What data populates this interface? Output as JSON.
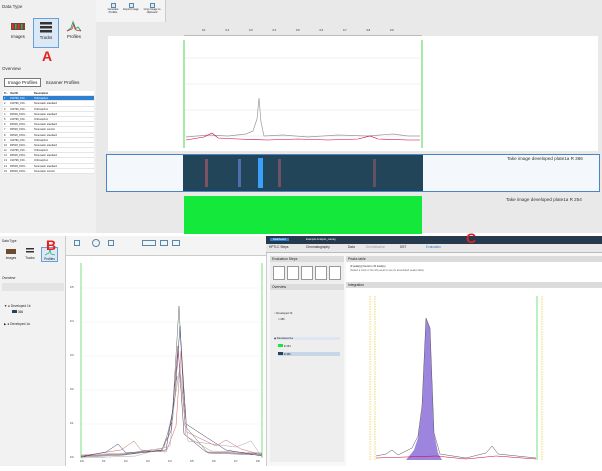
{
  "top_left": {
    "data_type_header": "Data Type",
    "type_buttons": [
      {
        "label": "Images",
        "icon": "images-icon"
      },
      {
        "label": "Tracks",
        "icon": "tracks-icon"
      },
      {
        "label": "Profiles",
        "icon": "profiles-icon"
      }
    ],
    "marker": "A",
    "overview_header": "Overview",
    "tabs": [
      "Image Profiles",
      "Scanner Profiles"
    ],
    "table": {
      "columns": [
        "Tr..",
        "Vial ID",
        "Description"
      ],
      "rows": [
        [
          "1",
          "310796_150...",
          "Orthosiphon"
        ],
        [
          "2",
          "310796_150...",
          "Sinensetin standard"
        ],
        [
          "3",
          "310796_150...",
          "Orthosiphon"
        ],
        [
          "4",
          "R3518_1501...",
          "Sinensetin standard"
        ],
        [
          "5",
          "310796_150...",
          "Orthosiphon"
        ],
        [
          "6",
          "R3518_1501...",
          "Sinensetin standard"
        ],
        [
          "7",
          "R3518_1501...",
          "Sinensetin control"
        ],
        [
          "8",
          "R3518_1501...",
          "Sinensetin standard"
        ],
        [
          "9",
          "310796_150...",
          "Orthosiphon"
        ],
        [
          "10",
          "R3518_1501...",
          "Sinensetin standard"
        ],
        [
          "11",
          "310796_150...",
          "Orthosiphon"
        ],
        [
          "12",
          "R3518_1501...",
          "Sinensetin standard"
        ],
        [
          "13",
          "310796_150...",
          "Orthosiphon"
        ],
        [
          "14",
          "R3518_1501...",
          "Sinensetin standard"
        ],
        [
          "15",
          "R3518_1501...",
          "Sinensetin control"
        ]
      ]
    }
  },
  "top_right": {
    "toolbar": [
      "Generate Profiles",
      "Export Image",
      "Copy Image to clipboard"
    ],
    "rf_ticks": [
      "0.1",
      "0.2",
      "0.3",
      "0.4",
      "0.5",
      "0.6",
      "0.7",
      "0.8",
      "0.9"
    ],
    "caption_366": "Take image developed plate1a R 366",
    "caption_254": "Take image developed plate1a R 254"
  },
  "bottom_left": {
    "data_type_header": "Data Type",
    "type_buttons": [
      {
        "label": "Images",
        "icon": "images-icon"
      },
      {
        "label": "Tracks",
        "icon": "tracks-icon"
      },
      {
        "label": "Profiles",
        "icon": "profiles-icon"
      }
    ],
    "marker": "B",
    "overview_header": "Overview",
    "tree": [
      "Developed 1b",
      "366",
      "Developed 1a"
    ],
    "y_ticks": [
      "0.5",
      "0.4",
      "0.3",
      "0.2",
      "0.1",
      "0.0"
    ],
    "x_ticks": [
      "0.0",
      "0.1",
      "0.2",
      "0.3",
      "0.4",
      "0.5",
      "0.6",
      "0.7",
      "0.8"
    ]
  },
  "bottom_right": {
    "title_tabs": [
      "Dashboard",
      "Example Analysis_camag"
    ],
    "marker": "C",
    "workflow_tabs": [
      "HPTLC Steps",
      "Chromatography",
      "Data",
      "Derivatization",
      "DST",
      "Evaluation"
    ],
    "evaluation_steps_header": "Evaluation Steps",
    "overview_header": "Overview",
    "tree": [
      "Developed 1b",
      "366",
      "Developed 1a",
      "R 254",
      "R 366"
    ],
    "peaks_header": "Peaks table",
    "peaks_note": "(0 peak(s)) found in 15 track(s)",
    "peaks_sub": "(Select a track in the left panel to see its associated peaks table)",
    "integration_header": "Integration"
  }
}
